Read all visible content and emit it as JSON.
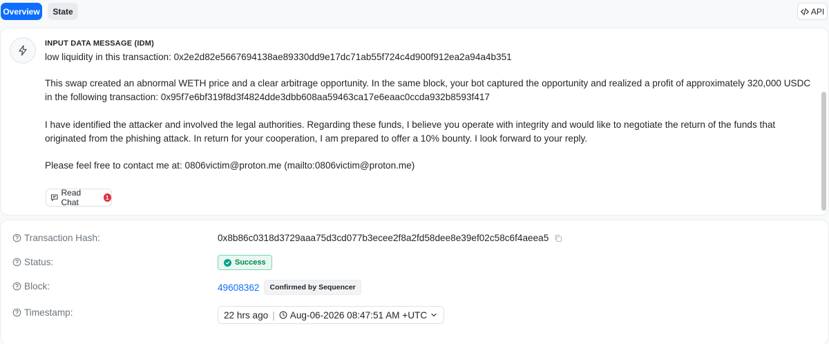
{
  "tabs": [
    {
      "label": "Overview",
      "active": true
    },
    {
      "label": "State",
      "active": false
    }
  ],
  "api_label": "API",
  "idm": {
    "title": "INPUT DATA MESSAGE (IDM)",
    "icon": "bolt-icon",
    "paragraphs": [
      "low liquidity in this transaction: 0x2e2d82e5667694138ae89330dd9e17dc71ab55f724c4d900f912ea2a94a4b351",
      "This swap created an abnormal WETH price and a clear arbitrage opportunity. In the same block, your bot captured the opportunity and realized a profit of approximately 320,000 USDC in the following transaction: 0x95f7e6bf319f8d3f4824dde3dbb608aa59463ca17e6eaac0ccda932b8593f417",
      "I have identified the attacker and involved the legal authorities. Regarding these funds, I believe you operate with integrity and would like to negotiate the return of the funds that originated from the phishing attack. In return for your cooperation, I am prepared to offer a 10% bounty. I look forward to your reply.",
      "Please feel free to contact me at: 0806victim@proton.me (mailto:0806victim@proton.me)"
    ],
    "read_chat_label": "Read Chat",
    "read_chat_count": "1"
  },
  "details": {
    "tx_hash_label": "Transaction Hash:",
    "tx_hash_value": "0x8b86c0318d3729aaa75d3cd077b3ecee2f8a2fd58dee8e39ef02c58c6f4aeea5",
    "status_label": "Status:",
    "status_value": "Success",
    "block_label": "Block:",
    "block_value": "49608362",
    "block_badge": "Confirmed by Sequencer",
    "timestamp_label": "Timestamp:",
    "timestamp_relative": "22 hrs ago",
    "timestamp_absolute": "Aug-06-2026 08:47:51 AM +UTC"
  },
  "colors": {
    "primary": "#0d6efd",
    "success": "#00864a",
    "danger": "#dc3545"
  }
}
